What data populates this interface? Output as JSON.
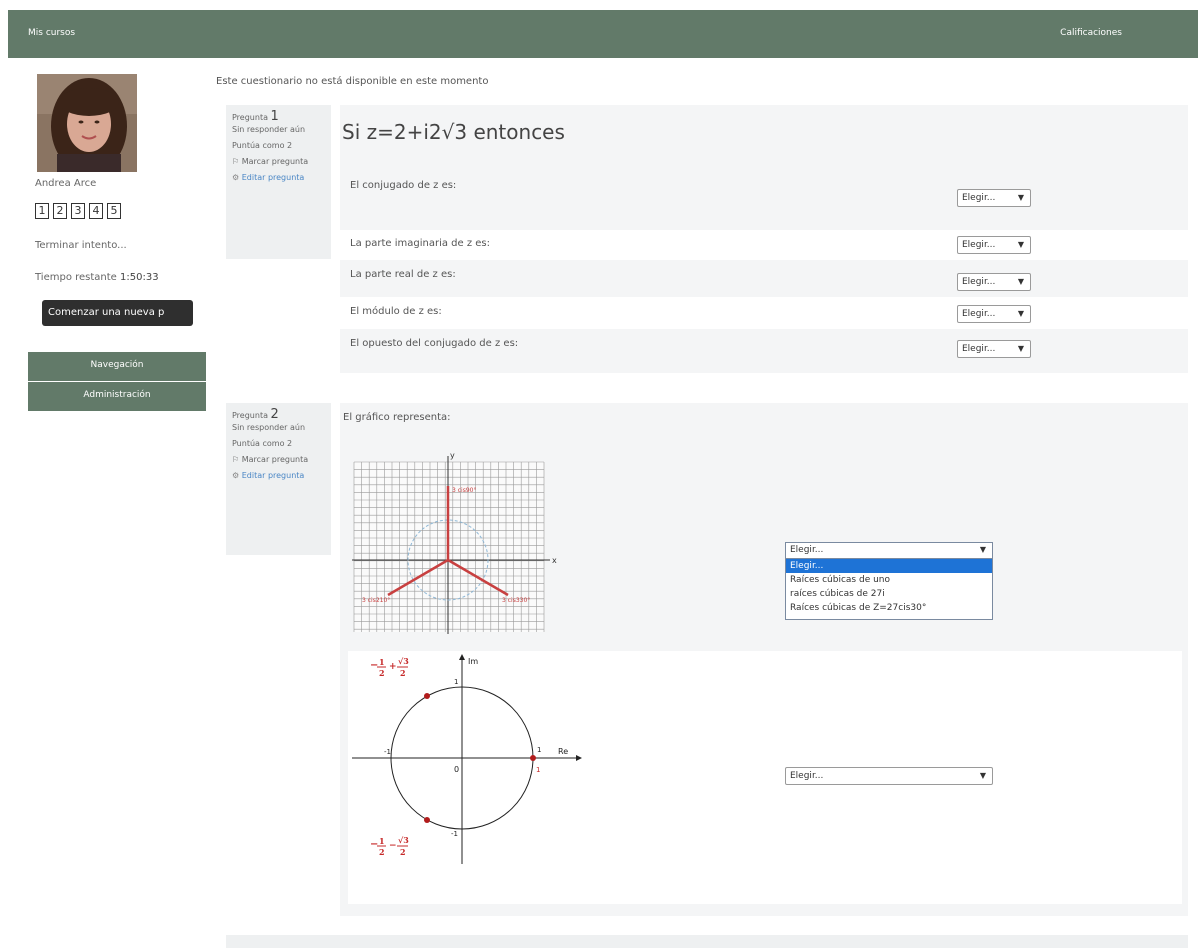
{
  "nav": {
    "my_courses": "Mis cursos",
    "grades": "Calificaciones"
  },
  "sidebar": {
    "user_name": "Andrea Arce",
    "question_numbers": [
      "1",
      "2",
      "3",
      "4",
      "5"
    ],
    "finish_attempt": "Terminar intento...",
    "time_remaining_label": "Tiempo restante",
    "time_remaining_value": "1:50:33",
    "start_new_button": "Comenzar una nueva p",
    "navigation_block": "Navegación",
    "administration_block": "Administración"
  },
  "notice": "Este cuestionario no está disponible en este momento",
  "question1": {
    "prefix": "Pregunta",
    "number": "1",
    "status": "Sin responder aún",
    "points": "Puntúa como 2",
    "flag": "Marcar pregunta",
    "edit": "Editar pregunta",
    "title": "Si z=2+i2√3 entonces",
    "rows": [
      {
        "label": "El conjugado de z es:",
        "select": "Elegir..."
      },
      {
        "label": "La parte imaginaria de z es:",
        "select": "Elegir..."
      },
      {
        "label": "La parte real de z es:",
        "select": "Elegir..."
      },
      {
        "label": "El módulo de z es:",
        "select": "Elegir..."
      },
      {
        "label": "El opuesto del conjugado de z es:",
        "select": "Elegir..."
      }
    ]
  },
  "question2": {
    "prefix": "Pregunta",
    "number": "2",
    "status": "Sin responder aún",
    "points": "Puntúa como 2",
    "flag": "Marcar pregunta",
    "edit": "Editar pregunta",
    "text": "El gráfico representa:",
    "dropdown_selected": "Elegir...",
    "dropdown_options": [
      "Elegir...",
      "Raíces cúbicas de uno",
      "raíces cúbicas de 27i",
      "Raíces cúbicas de Z=27cis30°"
    ],
    "second_select": "Elegir...",
    "graph1": {
      "y_label": "y",
      "x_label": "x",
      "pt_top": "3 cis90°",
      "pt_left": "3 cis210°",
      "pt_right": "3 cis330°"
    },
    "graph2": {
      "im_label": "Im",
      "re_label": "Re",
      "tick_one": "1",
      "tick_neg_one": "-1",
      "tick_top": "1",
      "tick_bottom": "-1",
      "origin": "0",
      "pt_right": "1",
      "frac_top_a": "1",
      "frac_top_b": "2",
      "frac_top_c": "√3",
      "frac_top_d": "2",
      "frac_bot_a": "1",
      "frac_bot_b": "2",
      "frac_bot_c": "√3",
      "frac_bot_d": "2"
    }
  },
  "colors": {
    "header": "#627a69",
    "dark_button": "#2f2f2f",
    "red": "#d42a2a",
    "link": "#4a86c5"
  }
}
